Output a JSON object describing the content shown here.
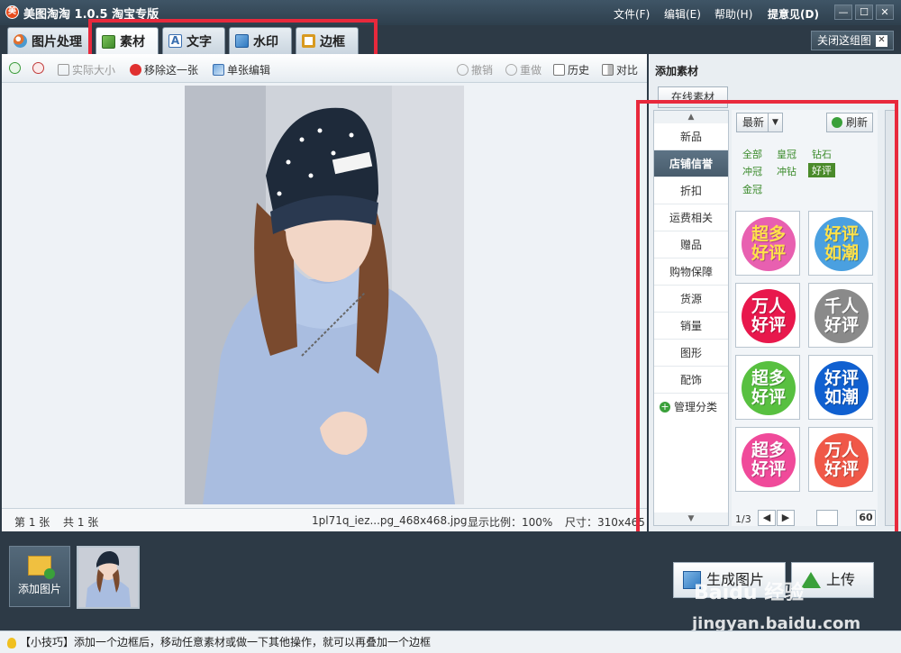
{
  "app": {
    "logo_glyph": "美",
    "title": "美图淘淘 1.0.5 淘宝专版",
    "menus": [
      "文件(F)",
      "编辑(E)",
      "帮助(H)",
      "提意见(D)"
    ],
    "window_buttons": [
      "—",
      "☐",
      "✕"
    ]
  },
  "tabs": [
    {
      "label": "图片处理",
      "icon": "palette-icon",
      "color": "#e07030"
    },
    {
      "label": "素材",
      "icon": "material-icon",
      "color": "#5a9a30"
    },
    {
      "label": "文字",
      "icon": "text-icon",
      "color": "#3a6fb0"
    },
    {
      "label": "水印",
      "icon": "watermark-icon",
      "color": "#2f79c0"
    },
    {
      "label": "边框",
      "icon": "frame-icon",
      "color": "#d89a20"
    }
  ],
  "close_group": {
    "label": "关闭这组图",
    "icon": "✕"
  },
  "toolbar": {
    "zoom_in": "",
    "zoom_out": "",
    "actual_size": "实际大小",
    "remove": "移除这一张",
    "single_edit": "单张编辑",
    "undo": "撤销",
    "redo": "重做",
    "history": "历史",
    "compare": "对比"
  },
  "status": {
    "index": "第 1 张",
    "total": "共 1 张",
    "filename": "1pl71q_iez...pg_468x468.jpg",
    "zoom": "显示比例：100%",
    "size": "尺寸：310x465"
  },
  "panel": {
    "title": "添加素材",
    "online": "在线素材",
    "categories": [
      "新品",
      "店铺信誉",
      "折扣",
      "运费相关",
      "赠品",
      "购物保障",
      "货源",
      "销量",
      "图形",
      "配饰"
    ],
    "active_category": 1,
    "manage": "管理分类",
    "sort": "最新",
    "refresh": "刷新",
    "tags": [
      "全部",
      "皇冠",
      "钻石",
      "冲冠",
      "冲钻",
      "好评",
      "金冠"
    ],
    "selected_tag": "好评",
    "stickers": [
      {
        "text": "超多\n好评",
        "color": "#e860b0",
        "text_color": "#ffe24a"
      },
      {
        "text": "好评\n如潮",
        "color": "#4aa0e0",
        "text_color": "#ffe24a"
      },
      {
        "text": "万人\n好评",
        "color": "#e8184c",
        "text_color": "#ffffff"
      },
      {
        "text": "千人\n好评",
        "color": "#8a8a8a",
        "text_color": "#ffffff"
      },
      {
        "text": "超多\n好评",
        "color": "#58c040",
        "text_color": "#ffffff"
      },
      {
        "text": "好评\n如潮",
        "color": "#1060d0",
        "text_color": "#ffffff"
      },
      {
        "text": "超多\n好评",
        "color": "#f04a9a",
        "text_color": "#ffffff"
      },
      {
        "text": "万人\n好评",
        "color": "#f05848",
        "text_color": "#ffffff"
      }
    ],
    "pager": {
      "page": "1/3",
      "input": "",
      "total": "60"
    }
  },
  "bottom": {
    "add_photo": "添加图片",
    "generate": "生成图片",
    "upload": "上传"
  },
  "hint": "【小技巧】添加一个边框后，移动任意素材或做一下其他操作，就可以再叠加一个边框",
  "watermark": {
    "line1": "Baidu 经验",
    "line2": "jingyan.baidu.com"
  },
  "colors": {
    "highlight": "#e8293c",
    "chrome": "#2d3a46"
  }
}
